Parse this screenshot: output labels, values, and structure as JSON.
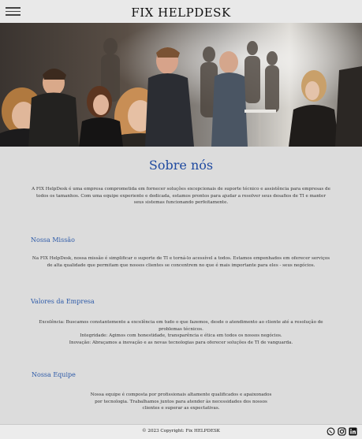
{
  "header": {
    "brand": "FIX HELPDESK"
  },
  "about": {
    "title": "Sobre nós",
    "text": "A FIX HelpDesk é uma empresa comprometida em fornecer soluções excepcionais de suporte técnico e assistência para empresas de todos os tamanhos. Com uma equipe experiente e dedicada, estamos prontos para ajudar a resolver seus desafios de TI e manter seus sistemas funcionando perfeitamente."
  },
  "mission": {
    "title": "Nossa Missão",
    "text": "Na FIX HelpDesk, nossa missão é simplificar o suporte de TI e torná-lo acessível a todos. Estamos empenhados em oferecer serviços de alta qualidade que permitam que nossos clientes se concentrem no que é mais importante para eles - seus negócios."
  },
  "values": {
    "title": "Valores da Empresa",
    "lines": [
      "Excelência: Buscamos constantemente a excelência em tudo o que fazemos, desde o atendimento ao cliente até a resolução de problemas técnicos.",
      "Integridade: Agimos com honestidade, transparência e ética em todos os nossos negócios.",
      "Inovação: Abraçamos a inovação e as novas tecnologias para oferecer soluções de TI de vanguarda."
    ]
  },
  "team": {
    "title": "Nossa Equipe",
    "text": "Nossa equipe é composta por profissionais altamente qualificados e apaixonados por tecnologia. Trabalhamos juntos para atender às necessidades dos nossos clientes e superar as expectativas."
  },
  "footer": {
    "copyright": "© 2023 Copyright: Fix HELPDESK",
    "social": [
      "whatsapp-icon",
      "instagram-icon",
      "linkedin-icon"
    ]
  }
}
